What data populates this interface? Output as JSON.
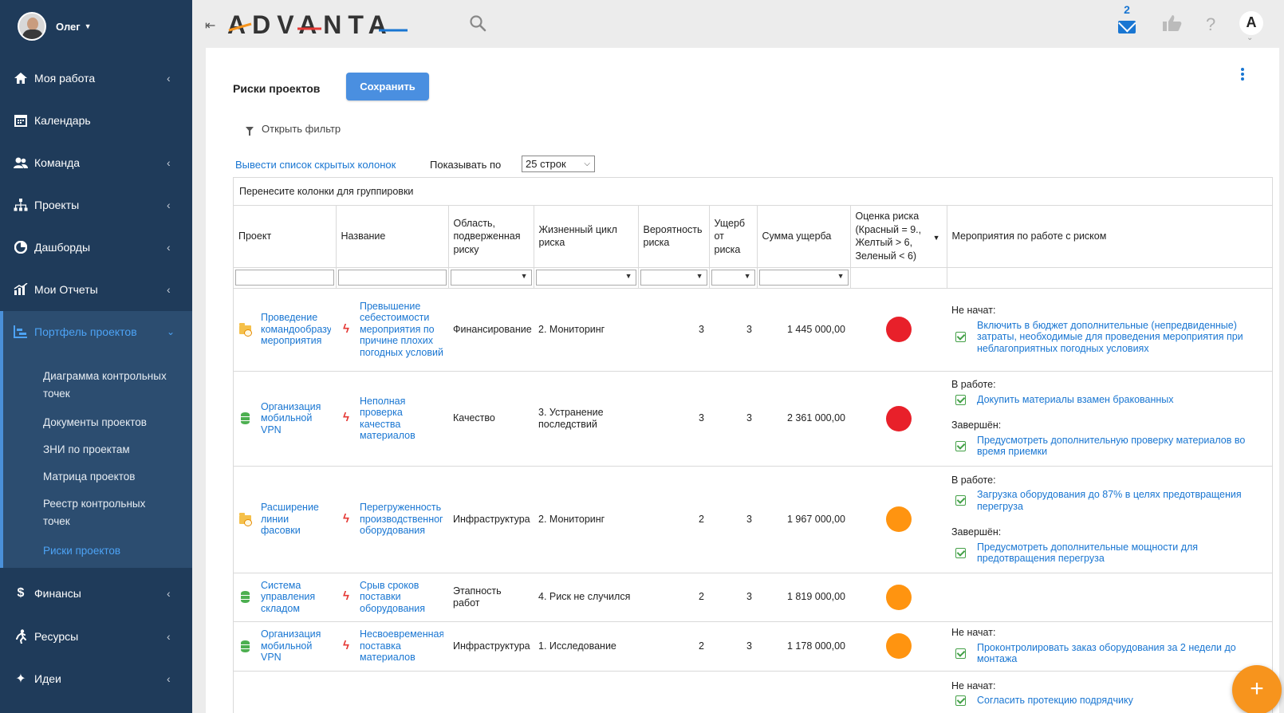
{
  "user": {
    "name": "Олег"
  },
  "sidebar": {
    "items": [
      {
        "label": "Моя работа",
        "icon": "home-icon",
        "glyph": "⌂",
        "has_children": true
      },
      {
        "label": "Календарь",
        "icon": "calendar-icon",
        "glyph": "▦",
        "has_children": false
      },
      {
        "label": "Команда",
        "icon": "team-icon",
        "glyph": "👥",
        "has_children": true
      },
      {
        "label": "Проекты",
        "icon": "hierarchy-icon",
        "glyph": "⊞",
        "has_children": true
      },
      {
        "label": "Дашборды",
        "icon": "dashboard-icon",
        "glyph": "◕",
        "has_children": true
      },
      {
        "label": "Мои Отчеты",
        "icon": "reports-icon",
        "glyph": "▥",
        "has_children": true
      },
      {
        "label": "Портфель проектов",
        "icon": "portfolio-icon",
        "glyph": "⊫",
        "has_children": true,
        "expanded": true
      },
      {
        "label": "Финансы",
        "icon": "dollar-icon",
        "glyph": "$",
        "has_children": true
      },
      {
        "label": "Ресурсы",
        "icon": "runner-icon",
        "glyph": "🏃",
        "has_children": true
      },
      {
        "label": "Идеи",
        "icon": "sparkle-icon",
        "glyph": "✦",
        "has_children": true
      }
    ],
    "portfolio_children": [
      {
        "label": "Диаграмма контрольных точек"
      },
      {
        "label": "Документы проектов"
      },
      {
        "label": "ЗНИ по проектам"
      },
      {
        "label": "Матрица проектов"
      },
      {
        "label": "Реестр контрольных точек"
      },
      {
        "label": "Риски проектов",
        "current": true
      }
    ]
  },
  "header": {
    "logo": "ADVANTA",
    "unread_messages": "2",
    "help": "?",
    "profile_letter": "A"
  },
  "page": {
    "title": "Риски проектов",
    "save_label": "Сохранить",
    "filter_label": "Открыть фильтр",
    "hidden_columns_link": "Вывести список скрытых колонок",
    "show_by_label": "Показывать по",
    "rows_per_page": "25 строк",
    "group_hint": "Перенесите колонки для группировки"
  },
  "table": {
    "columns": [
      "Проект",
      "Название",
      "Область, подверженная риску",
      "Жизненный цикл риска",
      "Вероятность риска",
      "Ущерб от риска",
      "Сумма ущерба",
      "Оценка риска (Красный = 9., Желтый > 6, Зеленый < 6)",
      "Мероприятия по работе с риском"
    ],
    "rows": [
      {
        "project": "Проведение командообразующего мероприятия",
        "project_icon": "folder-icon",
        "name": "Превышение себестоимости мероприятия по причине плохих погодных условий",
        "area": "Финансирование",
        "lifecycle": "2. Мониторинг",
        "probability": "3",
        "damage": "3",
        "amount": "1 445 000,00",
        "color": "#e8202a",
        "actions": [
          {
            "status": "Не начат:",
            "items": [
              "Включить в бюджет дополнительные (непредвиденные) затраты, необходимые для проведения мероприятия при неблагоприятных погодных условиях"
            ]
          }
        ]
      },
      {
        "project": "Организация мобильной VPN",
        "project_icon": "database-icon",
        "name": "Неполная проверка качества материалов",
        "area": "Качество",
        "lifecycle": "3. Устранение последствий",
        "probability": "3",
        "damage": "3",
        "amount": "2 361 000,00",
        "color": "#e8202a",
        "actions": [
          {
            "status": "В работе:",
            "items": [
              "Докупить материалы взамен бракованных"
            ]
          },
          {
            "status": "Завершён:",
            "items": [
              "Предусмотреть дополнительную проверку материалов во время приемки"
            ]
          }
        ]
      },
      {
        "project": "Расширение линии фасовки",
        "project_icon": "folder-icon",
        "name": "Перегруженность производственного оборудования",
        "area": "Инфраструктура",
        "lifecycle": "2. Мониторинг",
        "probability": "2",
        "damage": "3",
        "amount": "1 967 000,00",
        "color": "#ff9410",
        "actions": [
          {
            "status": "В работе:",
            "items": [
              "Загрузка оборудования до 87% в целях предотвращения перегруза"
            ]
          },
          {
            "status": "Завершён:",
            "items": [
              "Предусмотреть дополнительные мощности для предотвращения перегруза"
            ]
          }
        ]
      },
      {
        "project": "Система управления складом",
        "project_icon": "database-icon",
        "name": "Срыв сроков поставки оборудования",
        "area": "Этапность работ",
        "lifecycle": "4. Риск не случился",
        "probability": "2",
        "damage": "3",
        "amount": "1 819 000,00",
        "color": "#ff9410",
        "actions": []
      },
      {
        "project": "Организация мобильной VPN",
        "project_icon": "database-icon",
        "name": "Несвоевременная поставка материалов",
        "area": "Инфраструктура",
        "lifecycle": "1. Исследование",
        "probability": "2",
        "damage": "3",
        "amount": "1 178 000,00",
        "color": "#ff9410",
        "actions": [
          {
            "status": "Не начат:",
            "items": [
              "Проконтролировать заказ оборудования за 2 недели до монтажа"
            ]
          }
        ]
      },
      {
        "project": "",
        "project_icon": "",
        "name": "",
        "area": "",
        "lifecycle": "",
        "probability": "",
        "damage": "",
        "amount": "",
        "color": "",
        "actions": [
          {
            "status": "Не начат:",
            "items": [
              "Согласить протекцию подрядчику"
            ]
          }
        ]
      }
    ]
  },
  "fab": {
    "label": "+"
  },
  "colors": {
    "sidebar": "#1f3b5a",
    "accent": "#1976d2",
    "button": "#4a8fe0",
    "red": "#e8202a",
    "orange": "#ff9410",
    "fab": "#f7941d"
  }
}
